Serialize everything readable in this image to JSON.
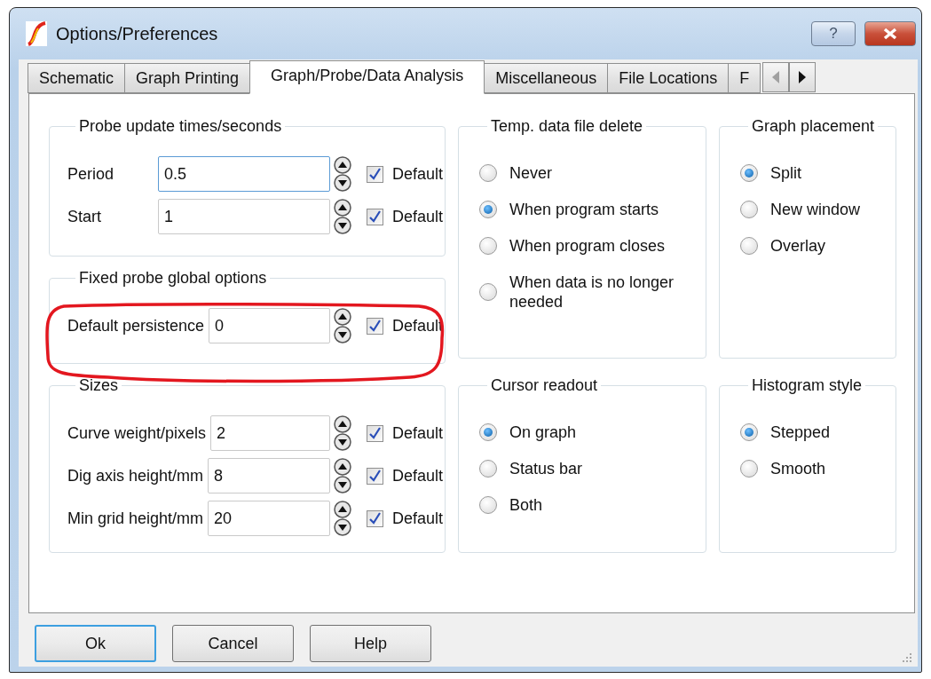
{
  "window": {
    "title": "Options/Preferences",
    "help_button": "?"
  },
  "tabs": [
    {
      "label": "Schematic",
      "selected": false
    },
    {
      "label": "Graph Printing",
      "selected": false
    },
    {
      "label": "Graph/Probe/Data Analysis",
      "selected": true
    },
    {
      "label": "Miscellaneous",
      "selected": false
    },
    {
      "label": "File Locations",
      "selected": false
    },
    {
      "label": "F",
      "selected": false
    }
  ],
  "columns": [
    [
      {
        "kind": "fields",
        "title": "Probe update times/seconds",
        "highlighted": false,
        "rows": [
          {
            "label": "Period",
            "value": "0.5",
            "focused": true,
            "checkbox": "Default",
            "checked": true
          },
          {
            "label": "Start",
            "value": "1",
            "focused": false,
            "checkbox": "Default",
            "checked": true
          }
        ]
      },
      {
        "kind": "fields",
        "title": "Fixed probe global options",
        "highlighted": true,
        "rows": [
          {
            "label": "Default persistence",
            "value": "0",
            "focused": false,
            "checkbox": "Default",
            "checked": true
          }
        ]
      },
      {
        "kind": "fields",
        "title": "Sizes",
        "highlighted": false,
        "rows": [
          {
            "label": "Curve weight/pixels",
            "value": "2",
            "focused": false,
            "checkbox": "Default",
            "checked": true
          },
          {
            "label": "Dig axis height/mm",
            "value": "8",
            "focused": false,
            "checkbox": "Default",
            "checked": true
          },
          {
            "label": "Min grid height/mm",
            "value": "20",
            "focused": false,
            "checkbox": "Default",
            "checked": true
          }
        ]
      }
    ],
    [
      {
        "kind": "options",
        "title": "Temp. data file delete",
        "highlighted": false,
        "options": [
          {
            "label": "Never",
            "selected": false
          },
          {
            "label": "When program starts",
            "selected": true
          },
          {
            "label": "When program closes",
            "selected": false
          },
          {
            "label": "When data is no longer needed",
            "selected": false
          }
        ]
      },
      {
        "kind": "options",
        "title": "Cursor readout",
        "highlighted": false,
        "options": [
          {
            "label": "On graph",
            "selected": true
          },
          {
            "label": "Status bar",
            "selected": false
          },
          {
            "label": "Both",
            "selected": false
          }
        ]
      }
    ],
    [
      {
        "kind": "options",
        "title": "Graph placement",
        "highlighted": false,
        "options": [
          {
            "label": "Split",
            "selected": true
          },
          {
            "label": "New window",
            "selected": false
          },
          {
            "label": "Overlay",
            "selected": false
          }
        ]
      },
      {
        "kind": "options",
        "title": "Histogram style",
        "highlighted": false,
        "options": [
          {
            "label": "Stepped",
            "selected": true
          },
          {
            "label": "Smooth",
            "selected": false
          }
        ]
      }
    ]
  ],
  "buttons": [
    {
      "label": "Ok",
      "focused": true
    },
    {
      "label": "Cancel",
      "focused": false
    },
    {
      "label": "Help",
      "focused": false
    }
  ]
}
